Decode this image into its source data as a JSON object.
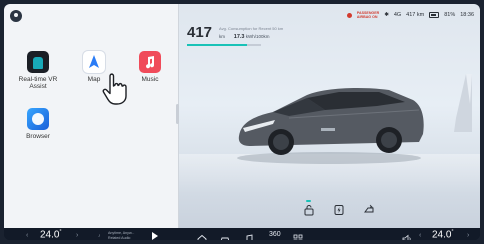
{
  "home": {
    "apps": [
      {
        "label": "Real-time VR Assist",
        "icon": "vr-assist-icon"
      },
      {
        "label": "Map",
        "icon": "map-icon"
      },
      {
        "label": "Music",
        "icon": "music-icon"
      },
      {
        "label": "Browser",
        "icon": "browser-icon"
      }
    ]
  },
  "vehicle": {
    "range_value": "417",
    "range_caption": "Avg. Consumption for Recent 50 km",
    "range_unit": "km",
    "consumption_value": "17.3",
    "consumption_unit": "kWh/100km",
    "range_fraction": 0.81
  },
  "status": {
    "airbag_line1": "PASSENGER",
    "airbag_line2": "AIRBAG ON",
    "signal": "4G",
    "range_text": "417 km",
    "battery_text": "81%",
    "time": "18:36"
  },
  "dock": {
    "driver_temp": "24.0",
    "passenger_temp": "24.0",
    "temp_unit": "°",
    "track_title": "Anytime, Anyw...",
    "track_subtitle": "Related Audio",
    "camera_360": "360"
  },
  "colors": {
    "accent": "#19c2b7",
    "music": "#f04b5a",
    "airbag": "#d23b2f"
  }
}
